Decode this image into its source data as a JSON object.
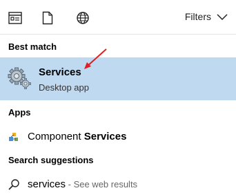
{
  "toolbar": {
    "filters_label": "Filters",
    "icons": [
      "apps-icon",
      "documents-icon",
      "web-globe-icon",
      "chevron-down-icon"
    ]
  },
  "sections": {
    "best_match": "Best match",
    "apps": "Apps",
    "suggestions": "Search suggestions"
  },
  "best_match": {
    "title": "Services",
    "subtitle": "Desktop app",
    "highlight_color": "#bfd9f1",
    "icon": "gear-services-icon"
  },
  "apps": [
    {
      "prefix": "Component ",
      "bold": "Services",
      "icon": "component-services-icon"
    }
  ],
  "suggestions": [
    {
      "query": "services",
      "suffix": " - See web results",
      "icon": "search-icon"
    }
  ],
  "annotation": {
    "arrow_color": "#e02020"
  }
}
